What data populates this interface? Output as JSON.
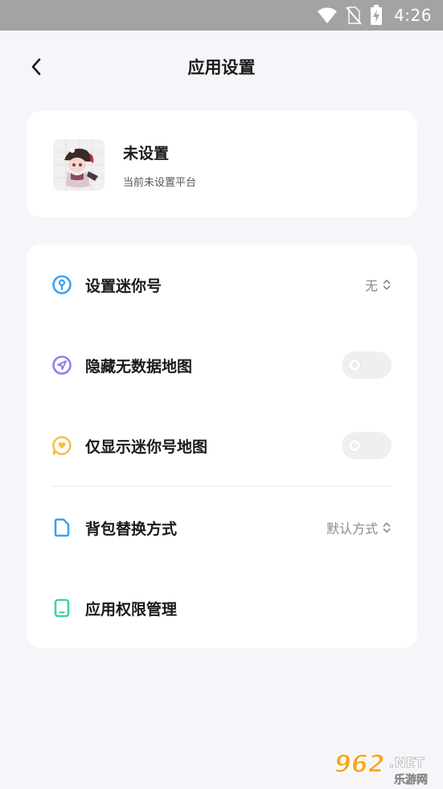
{
  "status_bar": {
    "time": "4:26"
  },
  "header": {
    "title": "应用设置"
  },
  "profile": {
    "name": "未设置",
    "subtitle": "当前未设置平台"
  },
  "settings": [
    {
      "label": "设置迷你号",
      "value": "无",
      "icon": "key-circle-icon",
      "color": "#3aa3f5"
    },
    {
      "label": "隐藏无数据地图",
      "toggle": false,
      "icon": "send-circle-icon",
      "color": "#8f7ef0"
    },
    {
      "label": "仅显示迷你号地图",
      "toggle": false,
      "icon": "heart-bubble-icon",
      "color": "#f5c242"
    },
    {
      "label": "背包替换方式",
      "value": "默认方式",
      "icon": "document-icon",
      "color": "#3aa3f5"
    },
    {
      "label": "应用权限管理",
      "icon": "tablet-icon",
      "color": "#3dd69a"
    }
  ],
  "watermark": {
    "number": "962",
    "domain": ".NET",
    "cn": "乐游网"
  }
}
